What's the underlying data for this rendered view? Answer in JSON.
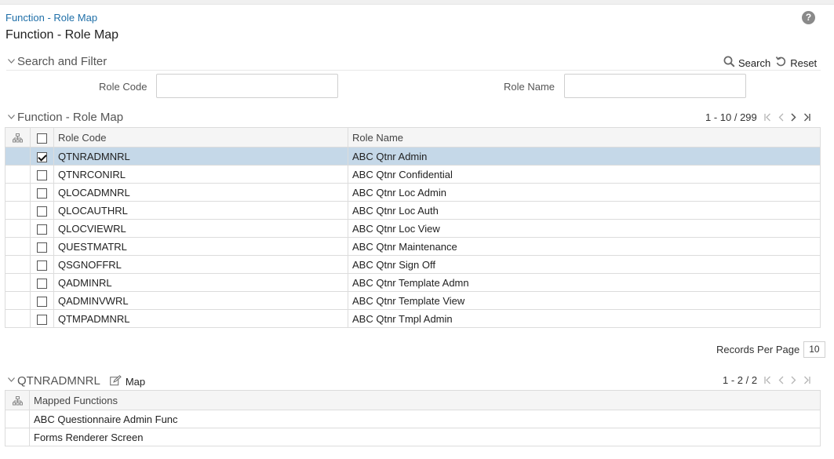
{
  "breadcrumb": "Function - Role Map",
  "page_title": "Function - Role Map",
  "help_icon_glyph": "?",
  "search_filter": {
    "title": "Search and Filter",
    "search_label": "Search",
    "reset_label": "Reset",
    "role_code_label": "Role Code",
    "role_name_label": "Role Name",
    "role_code_value": "",
    "role_name_value": ""
  },
  "role_map": {
    "title": "Function - Role Map",
    "pager_text": "1 - 10 / 299",
    "columns": [
      "Role Code",
      "Role Name"
    ],
    "rows": [
      {
        "code": "QTNRADMNRL",
        "name": "ABC Qtnr Admin",
        "selected": true
      },
      {
        "code": "QTNRCONIRL",
        "name": "ABC Qtnr Confidential",
        "selected": false
      },
      {
        "code": "QLOCADMNRL",
        "name": "ABC Qtnr Loc Admin",
        "selected": false
      },
      {
        "code": "QLOCAUTHRL",
        "name": "ABC Qtnr Loc Auth",
        "selected": false
      },
      {
        "code": "QLOCVIEWRL",
        "name": "ABC Qtnr Loc View",
        "selected": false
      },
      {
        "code": "QUESTMATRL",
        "name": "ABC Qtnr Maintenance",
        "selected": false
      },
      {
        "code": "QSGNOFFRL",
        "name": "ABC Qtnr Sign Off",
        "selected": false
      },
      {
        "code": "QADMINRL",
        "name": "ABC Qtnr Template Admn",
        "selected": false
      },
      {
        "code": "QADMINVWRL",
        "name": "ABC Qtnr Template View",
        "selected": false
      },
      {
        "code": "QTMPADMNRL",
        "name": "ABC Qtnr Tmpl Admin",
        "selected": false
      }
    ],
    "records_per_page_label": "Records Per Page",
    "records_per_page_value": "10"
  },
  "mapped": {
    "title": "QTNRADMNRL",
    "map_label": "Map",
    "pager_text": "1 - 2 / 2",
    "column": "Mapped Functions",
    "rows": [
      "ABC Questionnaire Admin Func",
      "Forms Renderer Screen"
    ]
  },
  "colors": {
    "link": "#1f6fa8",
    "selected_row": "#c5d8e8",
    "header_bg": "#f5f5f5"
  }
}
